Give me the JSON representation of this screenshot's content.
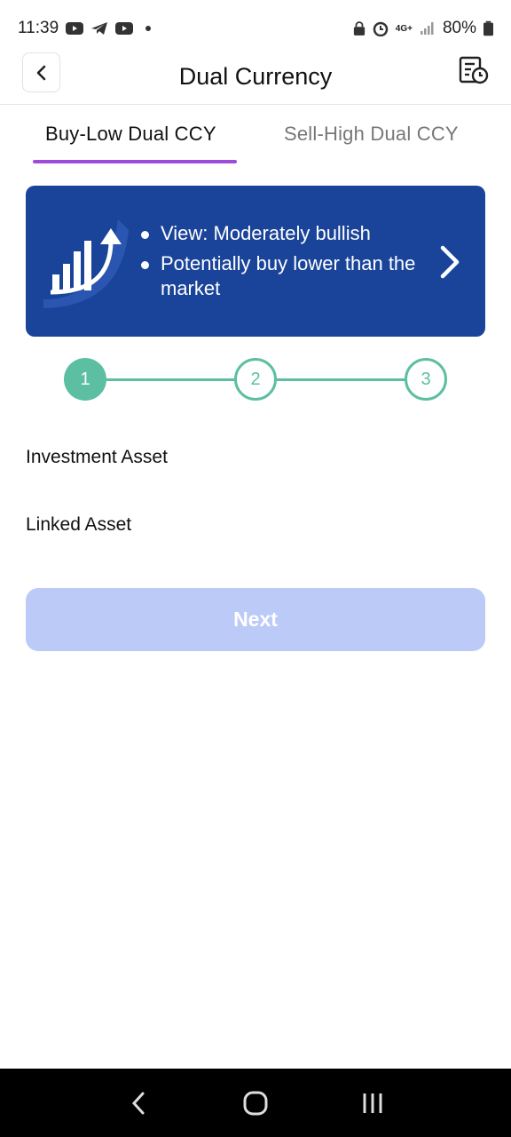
{
  "status_bar": {
    "time": "11:39",
    "battery": "80%",
    "network": "4G+"
  },
  "header": {
    "title": "Dual Currency"
  },
  "tabs": [
    {
      "label": "Buy-Low Dual CCY",
      "active": true
    },
    {
      "label": "Sell-High Dual CCY",
      "active": false
    }
  ],
  "banner": {
    "points": [
      "View: Moderately bullish",
      "Potentially buy lower than the market"
    ]
  },
  "stepper": {
    "steps": [
      "1",
      "2",
      "3"
    ],
    "current": 1
  },
  "form": {
    "investment_asset_label": "Investment Asset",
    "linked_asset_label": "Linked Asset"
  },
  "next_label": "Next",
  "colors": {
    "accent_purple": "#9d4bd9",
    "banner_blue": "#1a4499",
    "step_green": "#5cbfa2",
    "button_disabled": "#bccaf8"
  }
}
